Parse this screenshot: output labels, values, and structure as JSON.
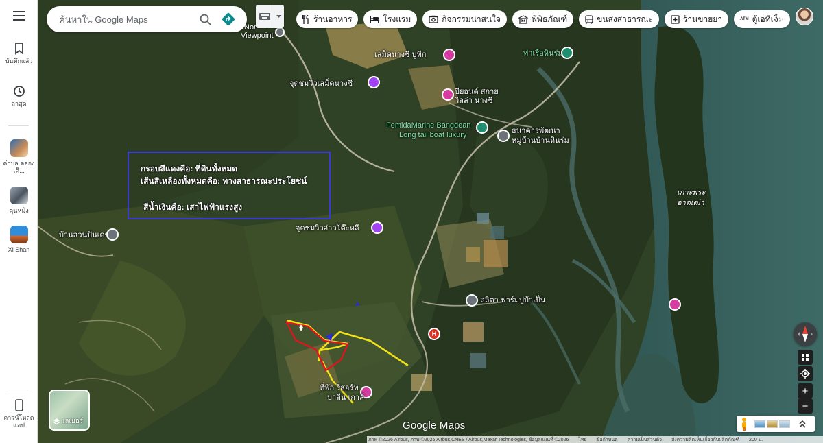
{
  "search": {
    "placeholder": "ค้นหาใน Google Maps"
  },
  "chips": [
    {
      "icon": "fork-knife-icon",
      "label": "ร้านอาหาร"
    },
    {
      "icon": "bed-icon",
      "label": "โรงแรม"
    },
    {
      "icon": "camera-icon",
      "label": "กิจกรรมน่าสนใจ"
    },
    {
      "icon": "museum-icon",
      "label": "พิพิธภัณฑ์"
    },
    {
      "icon": "bus-icon",
      "label": "ขนส่งสาธารณะ"
    },
    {
      "icon": "pharmacy-icon",
      "label": "ร้านขายยา"
    },
    {
      "icon": "atm-icon",
      "label": "ตู้เอทีเอ็ม"
    }
  ],
  "sidebar": {
    "menu_icon": "hamburger-menu-icon",
    "items": [
      {
        "label": "บันทึกแล้ว",
        "icon": "bookmark-icon"
      },
      {
        "label": "ล่าสุด",
        "icon": "history-icon"
      },
      {
        "label": "ค่าบล คลองเค็...",
        "icon": "place-thumbnail"
      },
      {
        "label": "คุนหมิง",
        "icon": "place-thumbnail"
      },
      {
        "label": "Xi Shan",
        "icon": "place-thumbnail"
      }
    ],
    "download_label": "ดาวน์โหลด แอป"
  },
  "map_labels": {
    "viewpoint_top_1": "Nor",
    "viewpoint_top_2": "Viewpoint",
    "semed": "เสม็ดนางชี บูทีก",
    "semed_view": "จุดชมวิวเสม็ดนางชี",
    "villa_1": "บียอนด์ สกาย",
    "villa_2": "วิลล่า นางชี",
    "harbor": "ท่าเรือหินร่ม",
    "femida_1": "FemidaMarine Bangdean",
    "femida_2": "Long tail boat luxury",
    "bank_1": "ธนาคารพัฒนา",
    "bank_2": "หมู่บ้านบ้านหินร่ม",
    "island_1": "เกาะพระ",
    "island_2": "อาดเฒ่า",
    "left_village": "บ้านสวนปันเดช",
    "ao_to_li": "จุดชมวิวอ่าวโต๊ะหลี",
    "farm": "ลลิตา ฟาร์มปูบ้าเป็น",
    "resort_1": "ที่พัก รีสอร์ท",
    "resort_2": "บาลีน เกาส์"
  },
  "annotation": {
    "line1": "กรอบสีแดงคือ: ที่ดินทั้งหมด",
    "line2": "เส้นสีเหลืองทั้งหมดคือ: ทางสาธารณะประโยชน์",
    "line3": "สีน้ำเงินคือ: เสาไฟฟ้าแรงสูง"
  },
  "layers_label": "เลเยอร์",
  "brand": "Google Maps",
  "footer": {
    "imagery": "ภาพ ©2026 Airbus, ภาพ ©2026 Airbus,CNES / Airbus,Maxar Technologies, ข้อมูลแผนที่ ©2026",
    "thai": "ไทย",
    "terms": "ข้อกำหนด",
    "privacy": "ความเป็นส่วนตัว",
    "feedback": "ส่งความคิดเห็นเกี่ยวกับผลิตภัณฑ์",
    "scale": "200 ม."
  },
  "colors": {
    "boundary_red": "#e0141e",
    "path_yellow": "#f2e21a",
    "pole_blue": "#2b2bd8",
    "annotation_border": "#3a3ad6"
  }
}
